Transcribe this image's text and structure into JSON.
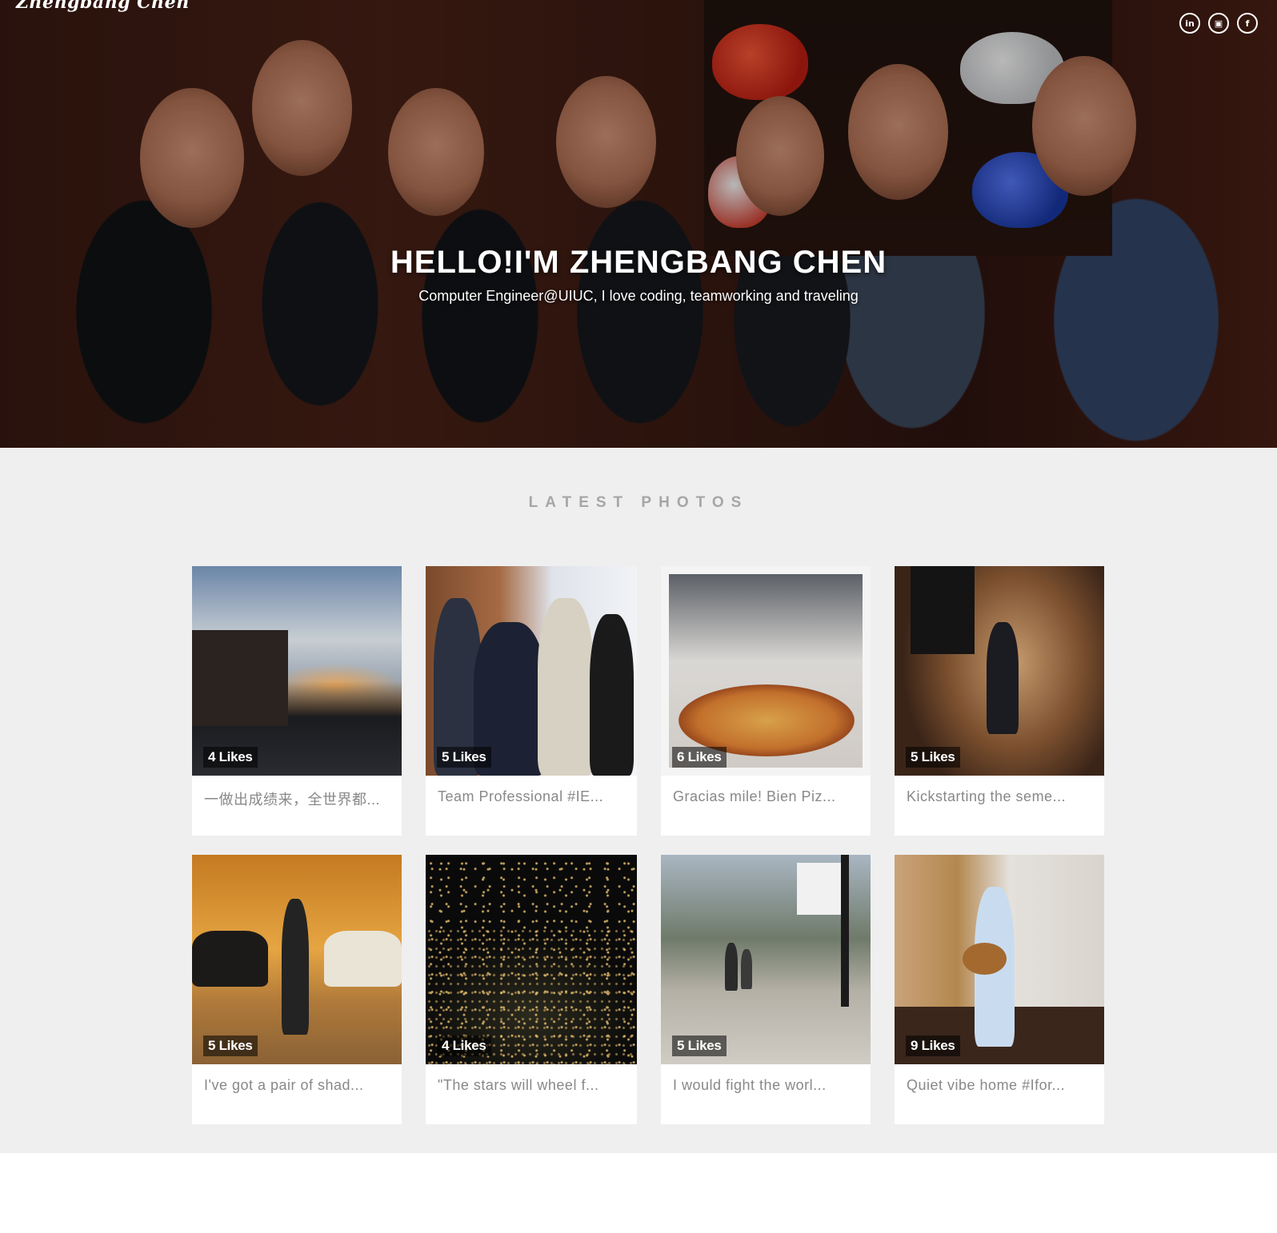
{
  "header": {
    "brand": "Zhengbang Chen",
    "social": [
      {
        "icon": "linkedin-icon",
        "glyph": "in"
      },
      {
        "icon": "instagram-icon",
        "glyph": "▣"
      },
      {
        "icon": "facebook-icon",
        "glyph": "f"
      }
    ]
  },
  "hero": {
    "title": "HELLO!I'M ZHENGBANG CHEN",
    "subtitle": "Computer Engineer@UIUC, I love coding, teamworking and traveling"
  },
  "photos": {
    "section_title": "LATEST PHOTOS",
    "items": [
      {
        "likes": "4 Likes",
        "caption": "一做出成绩来，全世界都..."
      },
      {
        "likes": "5 Likes",
        "caption": "Team Professional #IE..."
      },
      {
        "likes": "6 Likes",
        "caption": "Gracias mile! Bien Piz..."
      },
      {
        "likes": "5 Likes",
        "caption": "Kickstarting the seme..."
      },
      {
        "likes": "5 Likes",
        "caption": "I've got a pair of shad..."
      },
      {
        "likes": "4 Likes",
        "caption": "\"The stars will wheel f..."
      },
      {
        "likes": "5 Likes",
        "caption": "I would fight the worl..."
      },
      {
        "likes": "9 Likes",
        "caption": "Quiet vibe home #Ifor..."
      }
    ]
  }
}
